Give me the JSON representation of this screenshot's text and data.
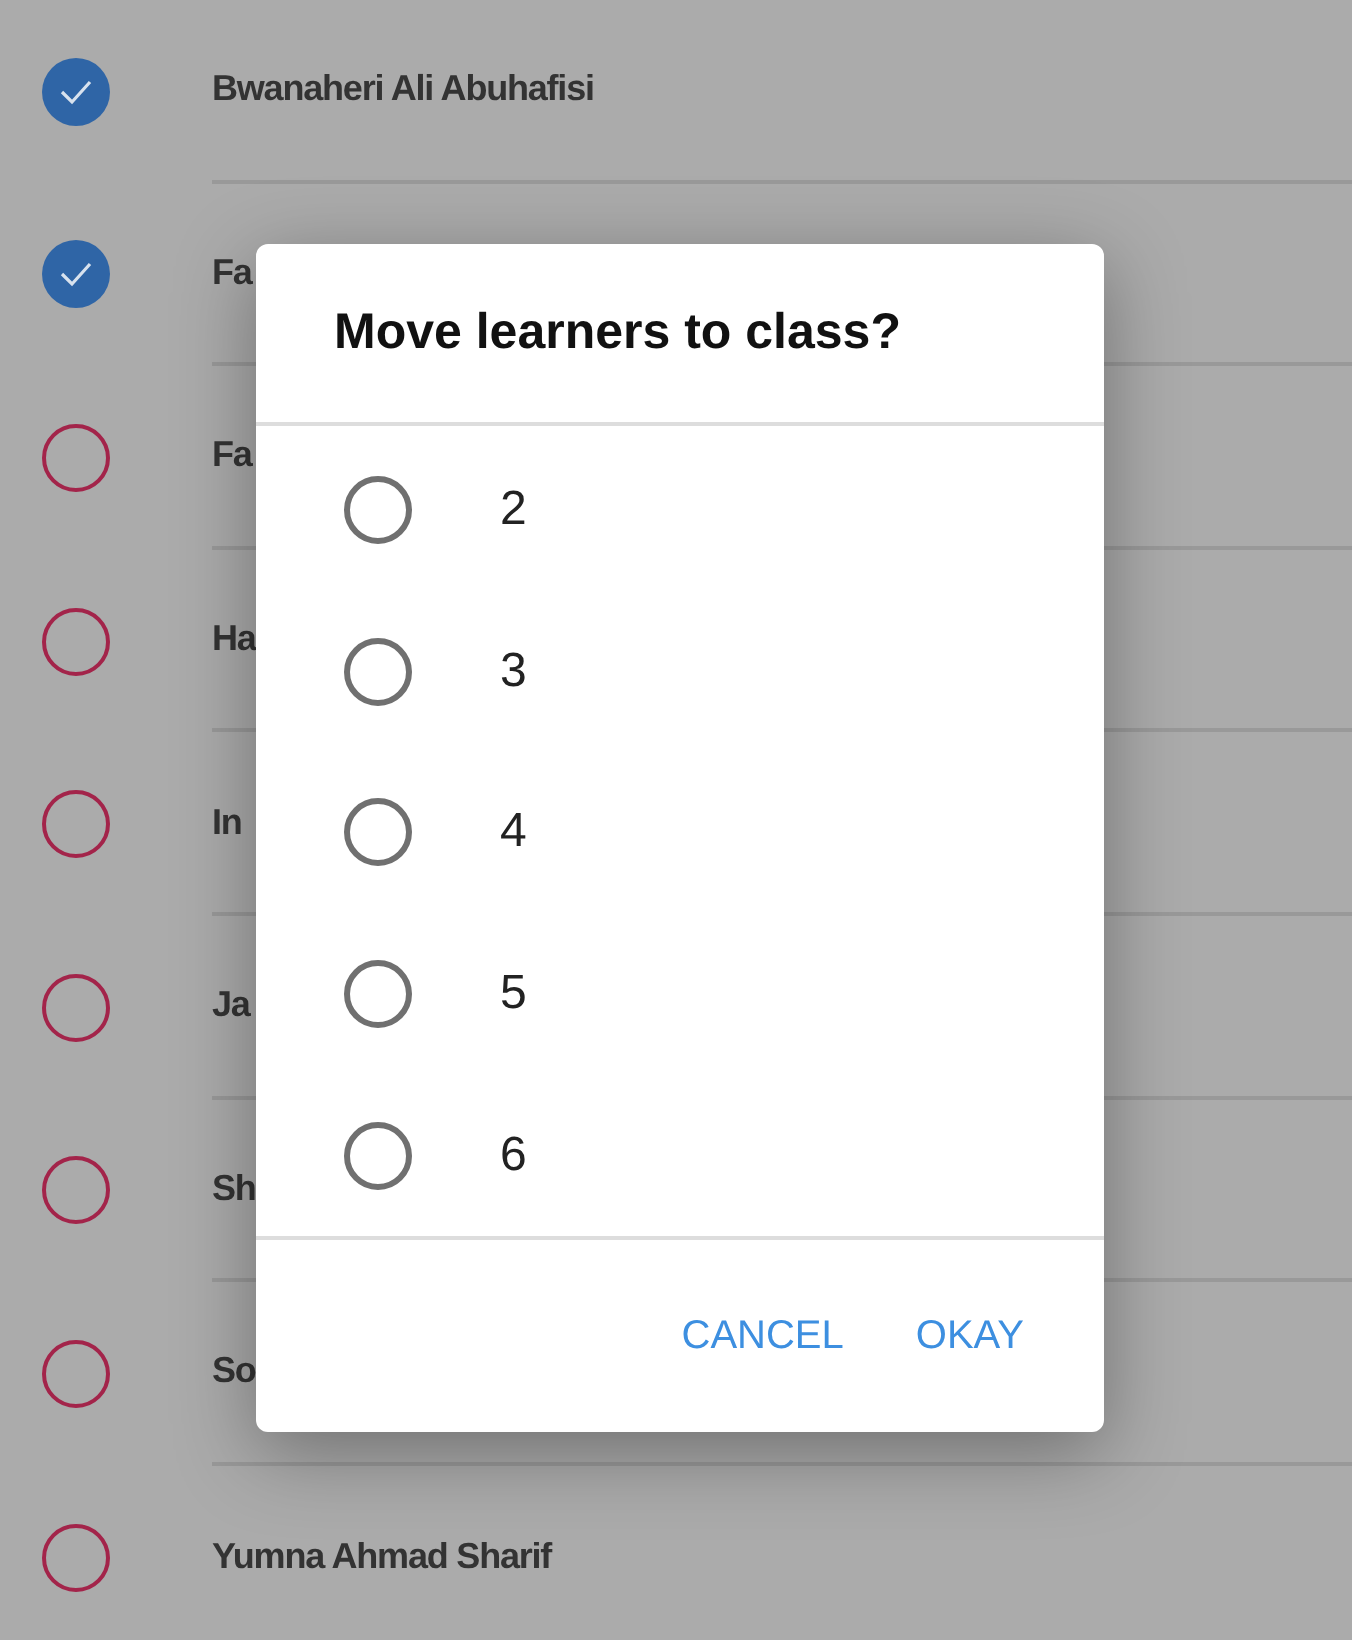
{
  "learners": [
    {
      "name": "Bwanaheri Ali Abuhafisi",
      "checked": true
    },
    {
      "name": "Fa",
      "checked": true
    },
    {
      "name": "Fa",
      "checked": false
    },
    {
      "name": "Ha",
      "checked": false
    },
    {
      "name": "In",
      "checked": false
    },
    {
      "name": "Ja",
      "checked": false
    },
    {
      "name": "Sh",
      "checked": false
    },
    {
      "name": "So",
      "checked": false
    },
    {
      "name": "Yumna Ahmad Sharif",
      "checked": false
    }
  ],
  "dialog": {
    "title": "Move learners to class?",
    "options": [
      {
        "label": "2",
        "selected": false
      },
      {
        "label": "3",
        "selected": false
      },
      {
        "label": "4",
        "selected": false
      },
      {
        "label": "5",
        "selected": false
      },
      {
        "label": "6",
        "selected": false
      }
    ],
    "buttons": [
      "CANCEL",
      "OKAY"
    ]
  }
}
